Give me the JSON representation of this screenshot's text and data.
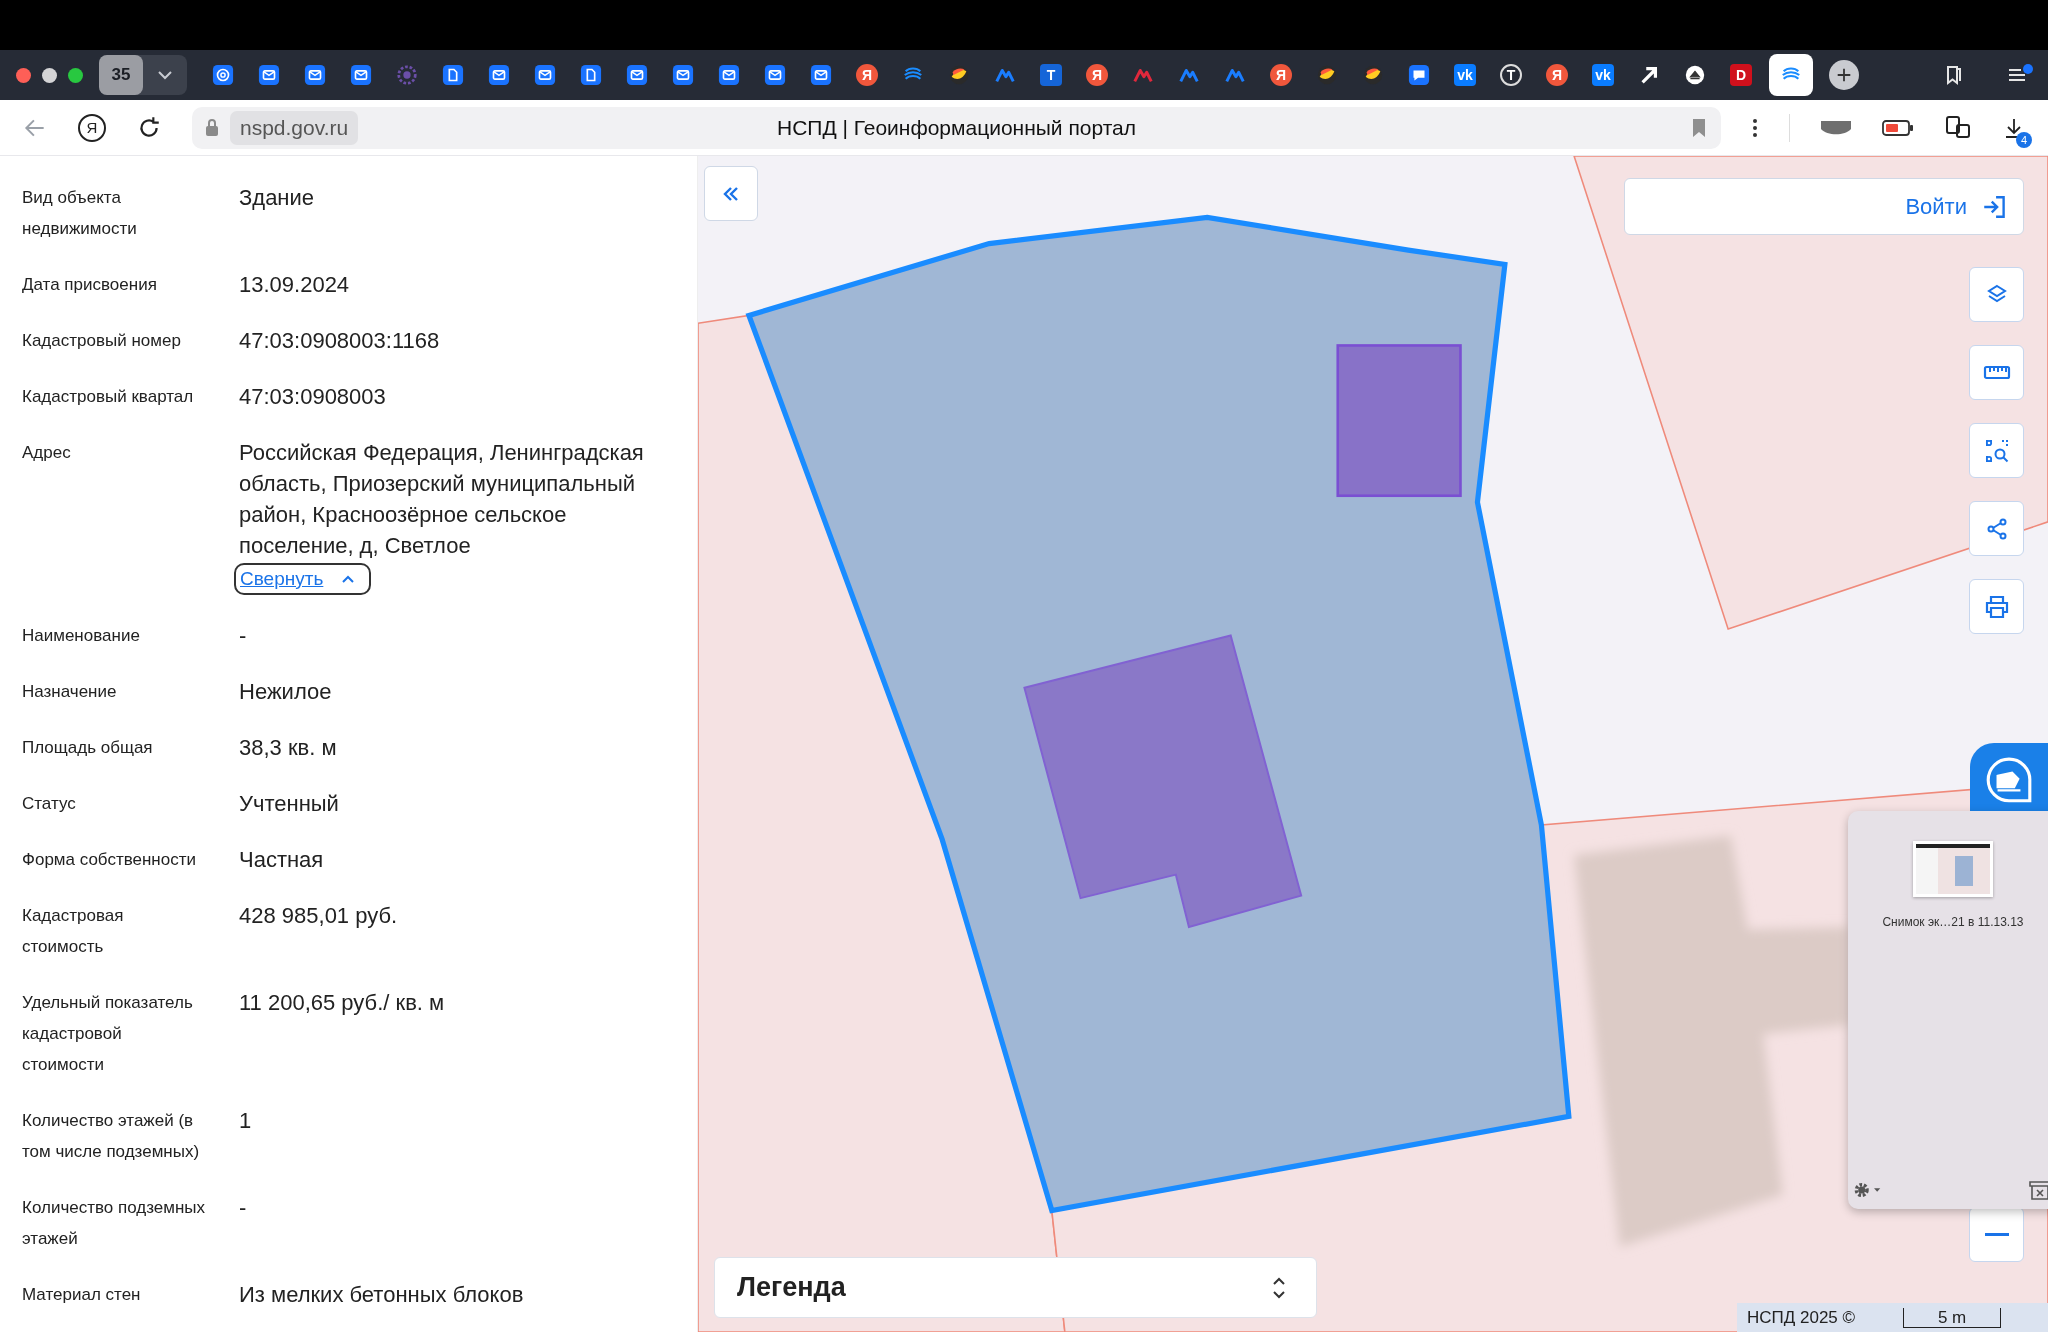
{
  "browser": {
    "tab_count": "35",
    "tabs": [
      {
        "kind": "mail-at",
        "selected": false
      },
      {
        "kind": "mail",
        "selected": false
      },
      {
        "kind": "mail",
        "selected": false
      },
      {
        "kind": "mail",
        "selected": false
      },
      {
        "kind": "flower",
        "selected": false
      },
      {
        "kind": "doc",
        "selected": false
      },
      {
        "kind": "mail",
        "selected": false
      },
      {
        "kind": "mail",
        "selected": false
      },
      {
        "kind": "doc",
        "selected": false
      },
      {
        "kind": "mail",
        "selected": false
      },
      {
        "kind": "mail",
        "selected": false
      },
      {
        "kind": "mail",
        "selected": false
      },
      {
        "kind": "mail",
        "selected": false
      },
      {
        "kind": "mail",
        "selected": false
      },
      {
        "kind": "ya",
        "glyph": "Я",
        "selected": false
      },
      {
        "kind": "wave",
        "selected": false
      },
      {
        "kind": "ball",
        "selected": false
      },
      {
        "kind": "peak",
        "selected": false
      },
      {
        "kind": "t-square",
        "glyph": "T",
        "selected": false
      },
      {
        "kind": "ya",
        "glyph": "Я",
        "selected": false
      },
      {
        "kind": "peak-red",
        "selected": false
      },
      {
        "kind": "peak",
        "selected": false
      },
      {
        "kind": "peak",
        "selected": false
      },
      {
        "kind": "ya",
        "glyph": "Я",
        "selected": false
      },
      {
        "kind": "ball",
        "selected": false
      },
      {
        "kind": "ball",
        "selected": false
      },
      {
        "kind": "chat",
        "selected": false
      },
      {
        "kind": "vk",
        "glyph": "vk",
        "selected": false
      },
      {
        "kind": "t-circle",
        "glyph": "T",
        "selected": false
      },
      {
        "kind": "ya",
        "glyph": "Я",
        "selected": false
      },
      {
        "kind": "vk",
        "glyph": "vk",
        "selected": false
      },
      {
        "kind": "arrow",
        "selected": false
      },
      {
        "kind": "up-circle",
        "selected": false
      },
      {
        "kind": "d-square",
        "glyph": "D",
        "selected": false
      },
      {
        "kind": "wave",
        "selected": true
      }
    ],
    "home_glyph": "Я",
    "url": "nspd.gov.ru",
    "page_title": "НСПД | Геоинформационный портал",
    "downloads_badge": "4"
  },
  "sidebar": {
    "rows": [
      {
        "label": "Вид объекта\nнедвижимости",
        "value": "Здание"
      },
      {
        "label": "Дата присвоения",
        "value": "13.09.2024"
      },
      {
        "label": "Кадастровый номер",
        "value": "47:03:0908003:1168"
      },
      {
        "label": "Кадастровый квартал",
        "value": "47:03:0908003"
      },
      {
        "label": "Адрес",
        "value": "Российская Федерация, Ленинградская область, Приозерский муниципальный район, Красноозёрное сельское поселение, д, Светлое",
        "toggle": {
          "label": "Свернуть",
          "expanded": true
        }
      },
      {
        "label": "Наименование",
        "value": "-"
      },
      {
        "label": "Назначение",
        "value": "Нежилое"
      },
      {
        "label": "Площадь общая",
        "value": "38,3 кв. м"
      },
      {
        "label": "Статус",
        "value": "Учтенный"
      },
      {
        "label": "Форма собственности",
        "value": "Частная"
      },
      {
        "label": "Кадастровая\nстоимость",
        "value": "428 985,01 руб."
      },
      {
        "label": "Удельный показатель\nкадастровой\nстоимости",
        "value": "11 200,65 руб./ кв. м"
      },
      {
        "label": "Количество этажей (в\nтом числе подземных)",
        "value": "1"
      },
      {
        "label": "Количество подземных\nэтажей",
        "value": "-"
      },
      {
        "label": "Материал стен",
        "value": "Из мелких бетонных блоков"
      }
    ]
  },
  "map": {
    "login_button": "Войти",
    "tools": [
      {
        "kind": "layers"
      },
      {
        "kind": "ruler"
      },
      {
        "kind": "select"
      },
      {
        "kind": "share"
      },
      {
        "kind": "print"
      }
    ],
    "legend": {
      "title": "Легенда"
    },
    "attribution": "НСПД 2025 ©",
    "scale": "5 m"
  },
  "screenshot_popover": {
    "filename": "Снимок эк…21 в 11.13.13"
  }
}
